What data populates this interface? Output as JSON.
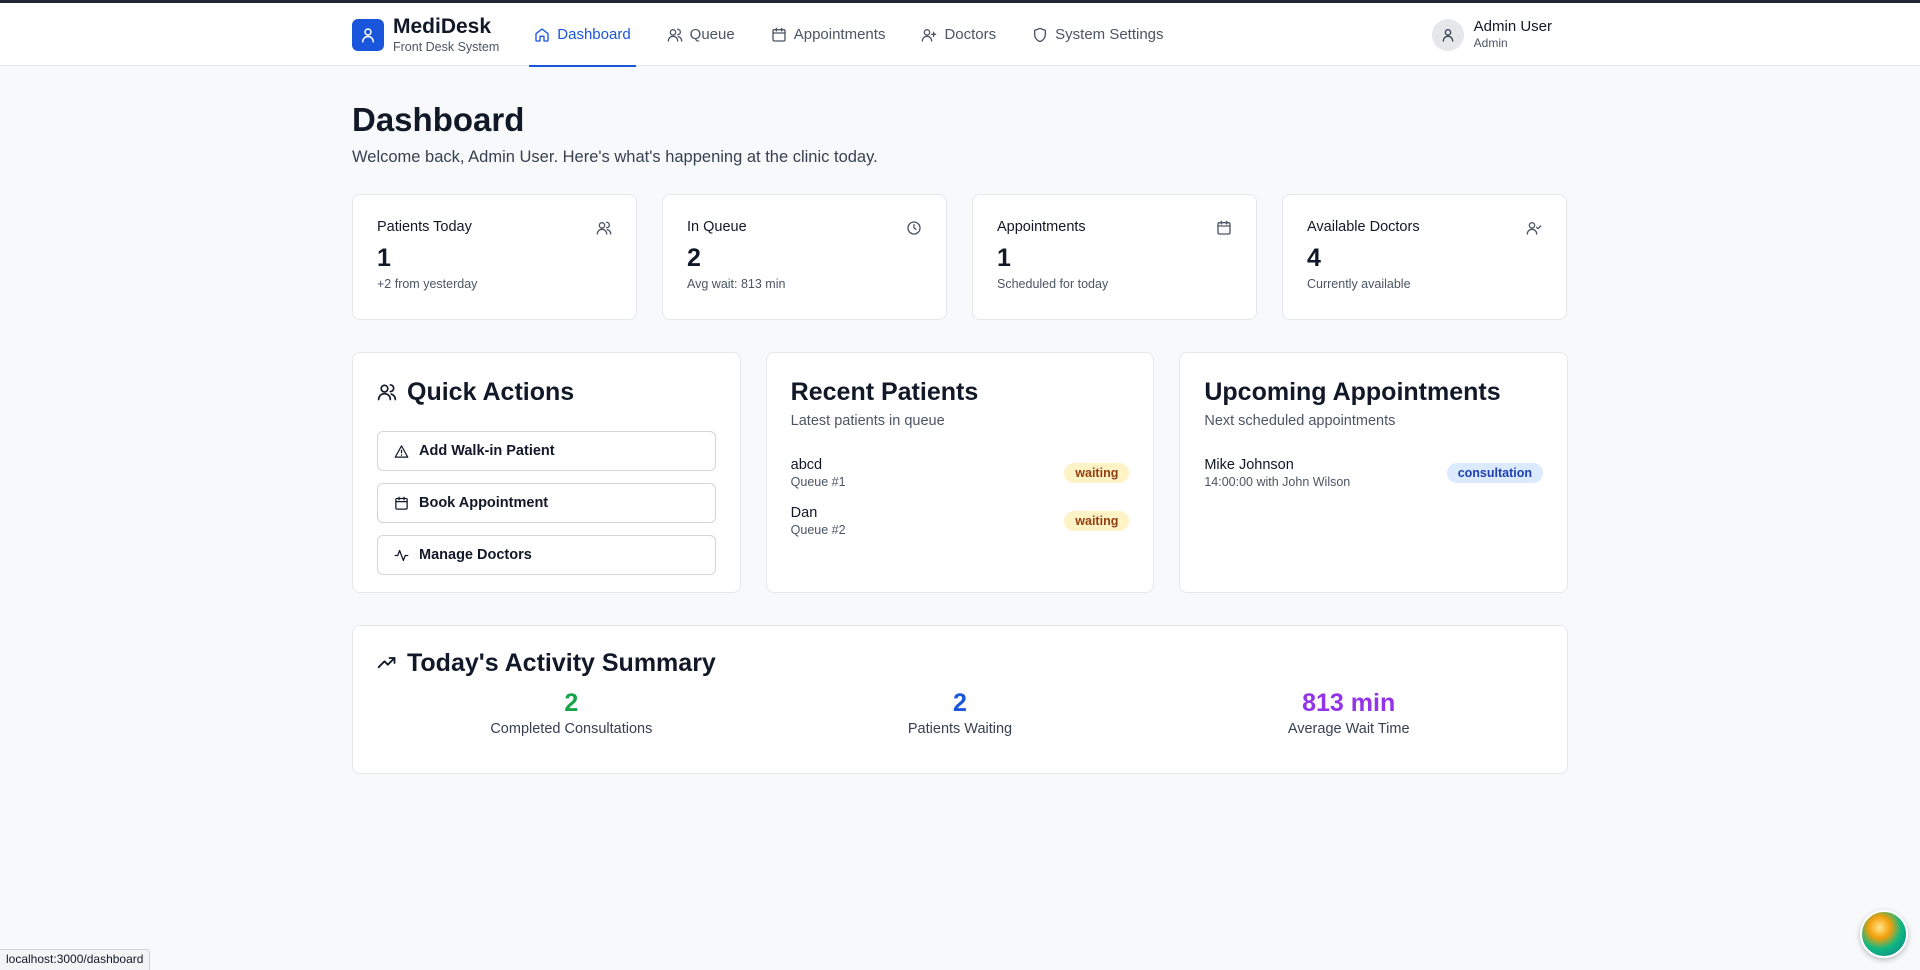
{
  "brand": {
    "name": "MediDesk",
    "subtitle": "Front Desk System"
  },
  "nav": [
    {
      "label": "Dashboard",
      "icon": "home-icon",
      "active": true
    },
    {
      "label": "Queue",
      "icon": "users-icon"
    },
    {
      "label": "Appointments",
      "icon": "calendar-icon"
    },
    {
      "label": "Doctors",
      "icon": "user-plus-icon"
    },
    {
      "label": "System Settings",
      "icon": "shield-icon"
    }
  ],
  "user": {
    "name": "Admin User",
    "role": "Admin"
  },
  "page": {
    "title": "Dashboard",
    "subtitle": "Welcome back, Admin User. Here's what's happening at the clinic today."
  },
  "stats": [
    {
      "label": "Patients Today",
      "value": "1",
      "note": "+2 from yesterday",
      "icon": "users-icon"
    },
    {
      "label": "In Queue",
      "value": "2",
      "note": "Avg wait: 813 min",
      "icon": "clock-icon"
    },
    {
      "label": "Appointments",
      "value": "1",
      "note": "Scheduled for today",
      "icon": "calendar-icon"
    },
    {
      "label": "Available Doctors",
      "value": "4",
      "note": "Currently available",
      "icon": "user-check-icon"
    }
  ],
  "quick_actions": {
    "title": "Quick Actions",
    "buttons": [
      {
        "label": "Add Walk-in Patient",
        "icon": "alert-triangle-icon"
      },
      {
        "label": "Book Appointment",
        "icon": "calendar-icon"
      },
      {
        "label": "Manage Doctors",
        "icon": "activity-icon"
      }
    ]
  },
  "recent_patients": {
    "title": "Recent Patients",
    "description": "Latest patients in queue",
    "items": [
      {
        "name": "abcd",
        "sub": "Queue #1",
        "status": "waiting"
      },
      {
        "name": "Dan",
        "sub": "Queue #2",
        "status": "waiting"
      }
    ]
  },
  "upcoming": {
    "title": "Upcoming Appointments",
    "description": "Next scheduled appointments",
    "items": [
      {
        "name": "Mike Johnson",
        "sub": "14:00:00 with John Wilson",
        "type": "consultation"
      }
    ]
  },
  "summary": {
    "title": "Today's Activity Summary",
    "items": [
      {
        "value": "2",
        "label": "Completed Consultations",
        "color": "#16a34a"
      },
      {
        "value": "2",
        "label": "Patients Waiting",
        "color": "#1a56db"
      },
      {
        "value": "813 min",
        "label": "Average Wait Time",
        "color": "#9333ea"
      }
    ]
  },
  "status_bar": {
    "url": "localhost:3000/dashboard"
  },
  "colors": {
    "accent": "#1a56db",
    "badge_waiting": "#fef3c7",
    "badge_consultation": "#dbeafe"
  }
}
